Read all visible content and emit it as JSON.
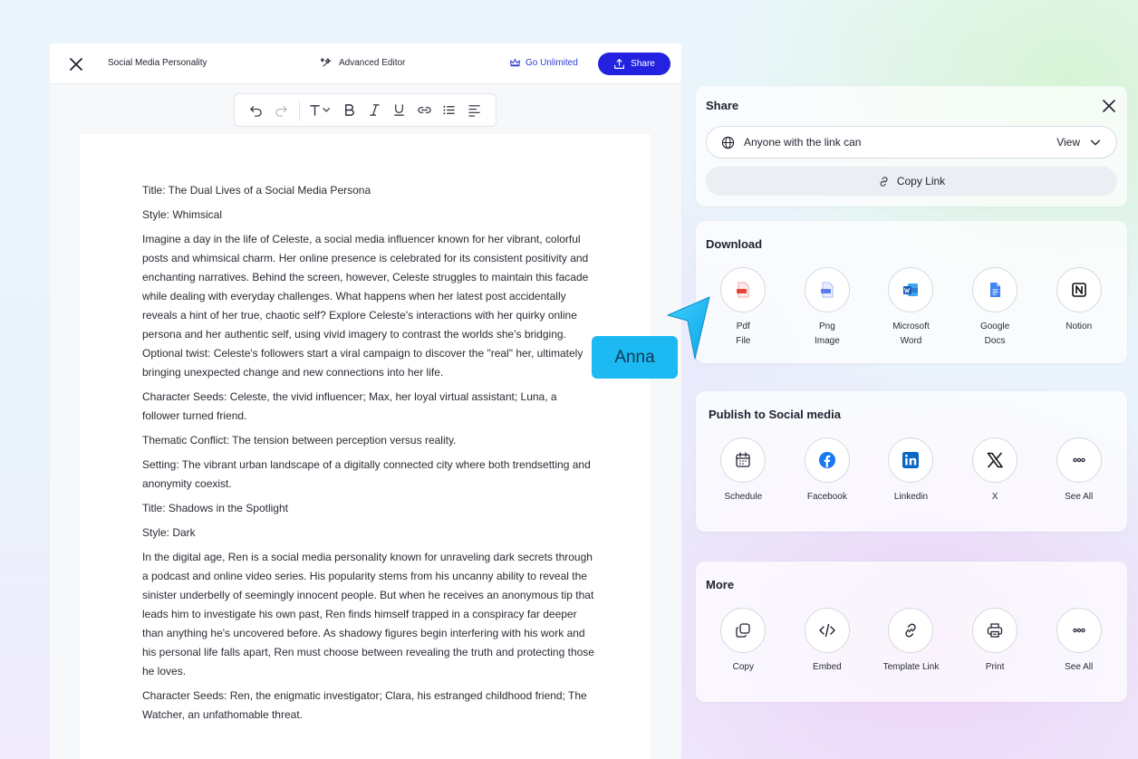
{
  "editor": {
    "doc_name": "Social Media Personality",
    "advanced_editor": "Advanced Editor",
    "go_unlimited": "Go Unlimited",
    "share": "Share",
    "toolbar_icons": [
      "undo-icon",
      "redo-icon",
      "text-size-icon",
      "bold-icon",
      "italic-icon",
      "underline-icon",
      "link-icon",
      "bullet-list-icon",
      "align-left-icon"
    ],
    "paragraphs": [
      "Title: The Dual Lives of a Social Media Persona",
      "Style: Whimsical",
      "Imagine a day in the life of Celeste, a social media influencer known for her vibrant, colorful posts and whimsical charm. Her online presence is celebrated for its consistent positivity and enchanting narratives. Behind the screen, however, Celeste struggles to maintain this facade while dealing with everyday challenges. What happens when her latest post accidentally reveals a hint of her true, chaotic self? Explore Celeste's interactions with her quirky online persona and her authentic self, using vivid imagery to contrast the worlds she's bridging. Optional twist: Celeste's followers start a viral campaign to discover the \"real\" her, ultimately bringing unexpected change and new connections into her life.",
      "Character Seeds: Celeste, the vivid influencer; Max, her loyal virtual assistant; Luna, a follower turned friend.",
      "Thematic Conflict: The tension between perception versus reality.",
      "Setting: The vibrant urban landscape of a digitally connected city where both trendsetting and anonymity coexist.",
      "Title: Shadows in the Spotlight",
      "Style: Dark",
      "In the digital age, Ren is a social media personality known for unraveling dark secrets through a podcast and online video series. His popularity stems from his uncanny ability to reveal the sinister underbelly of seemingly innocent people. But when he receives an anonymous tip that leads him to investigate his own past, Ren finds himself trapped in a conspiracy far deeper than anything he's uncovered before. As shadowy figures begin interfering with his work and his personal life falls apart, Ren must choose between revealing the truth and protecting those he loves.",
      "Character Seeds: Ren, the enigmatic investigator; Clara, his estranged childhood friend; The Watcher, an unfathomable threat."
    ]
  },
  "share_panel": {
    "title": "Share",
    "access_label": "Anyone with the link can",
    "access_value": "View",
    "copy_link": "Copy Link"
  },
  "download": {
    "title": "Download",
    "items": [
      {
        "line1": "Pdf",
        "line2": "File"
      },
      {
        "line1": "Png",
        "line2": "Image"
      },
      {
        "line1": "Microsoft",
        "line2": "Word"
      },
      {
        "line1": "Google",
        "line2": "Docs"
      },
      {
        "line1": "Notion",
        "line2": ""
      }
    ]
  },
  "social": {
    "title": "Publish to Social media",
    "items": [
      "Schedule",
      "Facebook",
      "Linkedin",
      "X",
      "See All"
    ]
  },
  "more": {
    "title": "More",
    "items": [
      "Copy",
      "Embed",
      "Template Link",
      "Print",
      "See All"
    ]
  },
  "cursor_tag": "Anna",
  "colors": {
    "primary": "#2222e0",
    "accent_link": "#2d3cd8",
    "tag": "#1cb9f2"
  }
}
